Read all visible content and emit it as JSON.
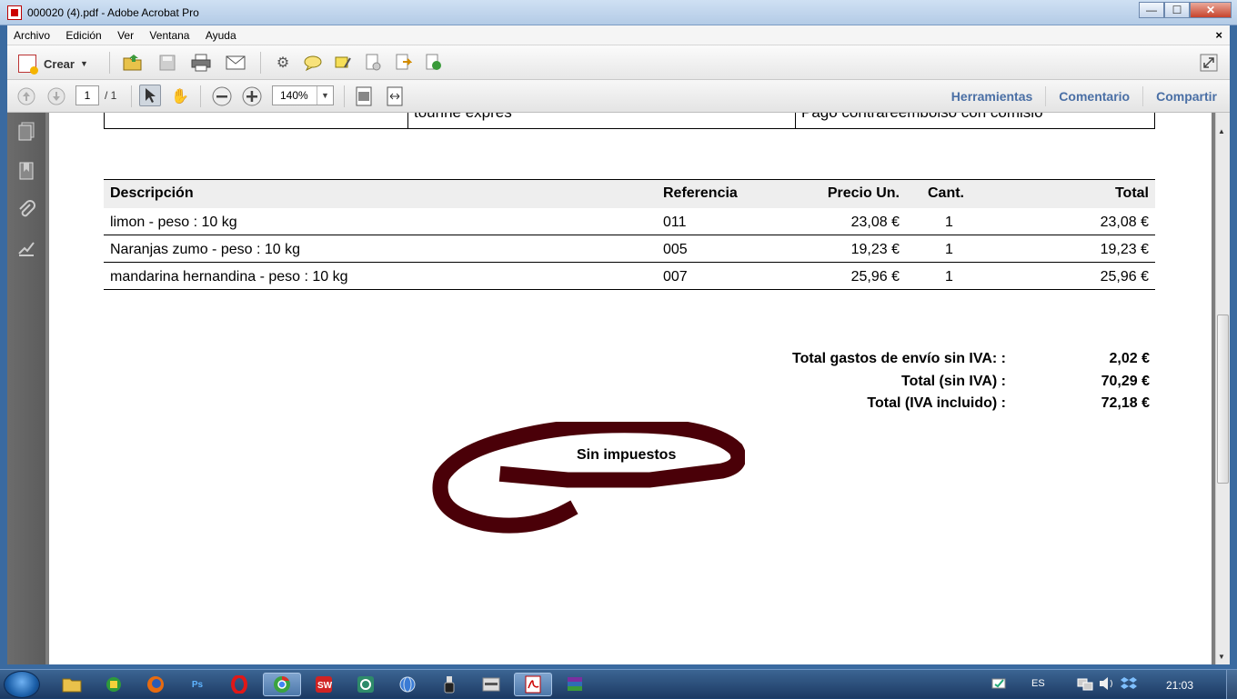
{
  "window": {
    "title": "000020 (4).pdf - Adobe Acrobat Pro",
    "controls": {
      "minimize": "—",
      "maximize": "☐",
      "close": "✕"
    }
  },
  "menu": {
    "items": [
      "Archivo",
      "Edición",
      "Ver",
      "Ventana",
      "Ayuda"
    ],
    "close": "×"
  },
  "toolbar": {
    "create_label": "Crear",
    "page_current": "1",
    "page_total": "/ 1",
    "zoom": "140%",
    "tools_link": "Herramientas",
    "comment_link": "Comentario",
    "share_link": "Compartir"
  },
  "document": {
    "top_row": {
      "col2": "tourine expres",
      "col3": "Pago contrareembolso con comisio"
    },
    "table": {
      "headers": {
        "description": "Descripción",
        "reference": "Referencia",
        "unit_price": "Precio Un.",
        "quantity": "Cant.",
        "total": "Total"
      },
      "rows": [
        {
          "description": "limon - peso : 10 kg",
          "reference": "011",
          "unit_price": "23,08 €",
          "quantity": "1",
          "total": "23,08 €"
        },
        {
          "description": "Naranjas zumo - peso : 10 kg",
          "reference": "005",
          "unit_price": "19,23 €",
          "quantity": "1",
          "total": "19,23 €"
        },
        {
          "description": "mandarina hernandina - peso : 10 kg",
          "reference": "007",
          "unit_price": "25,96 €",
          "quantity": "1",
          "total": "25,96 €"
        }
      ]
    },
    "totals": [
      {
        "label": "Total gastos de envío sin IVA: :",
        "value": "2,02 €"
      },
      {
        "label": "Total (sin IVA) :",
        "value": "70,29 €"
      },
      {
        "label": "Total (IVA incluido) :",
        "value": "72,18 €"
      }
    ],
    "annotation": {
      "text": "Sin impuestos",
      "color": "#4a0008"
    }
  },
  "taskbar": {
    "apps": [
      "explorer-icon",
      "app-green-icon",
      "firefox-icon",
      "photoshop-icon",
      "opera-icon",
      "chrome-icon",
      "app-sw-icon",
      "app-g-icon",
      "app-globe-icon",
      "usb-icon",
      "seo-icon",
      "acrobat-icon",
      "winrar-icon"
    ],
    "language": "ES",
    "clock": "21:03"
  }
}
